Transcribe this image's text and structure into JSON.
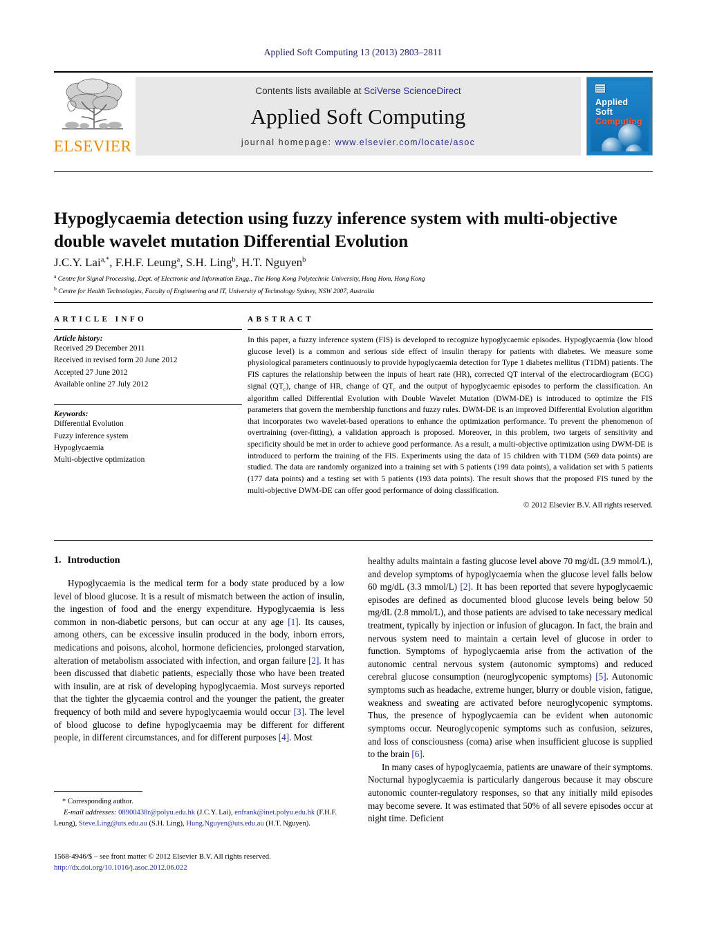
{
  "running_head": "Applied Soft Computing 13 (2013) 2803–2811",
  "masthead": {
    "publisher_name": "ELSEVIER",
    "contents_prefix": "Contents lists available at ",
    "contents_link": "SciVerse ScienceDirect",
    "journal_title": "Applied Soft Computing",
    "homepage_label": "journal homepage:",
    "homepage_url": "www.elsevier.com/locate/asoc",
    "cover": {
      "line1": "Applied",
      "line2": "Soft",
      "line3": "Computing",
      "bg_color": "#1b7fc4",
      "accent_color": "#ff5533"
    }
  },
  "article": {
    "title": "Hypoglycaemia detection using fuzzy inference system with multi-objective double wavelet mutation Differential Evolution",
    "authors_html": "J.C.Y. Lai<sup>a,*</sup>, F.H.F. Leung<sup>a</sup>, S.H. Ling<sup>b</sup>, H.T. Nguyen<sup>b</sup>",
    "affiliation_a": "Centre for Signal Processing, Dept. of Electronic and Information Engg., The Hong Kong Polytechnic University, Hung Hom, Hong Kong",
    "affiliation_b": "Centre for Health Technologies, Faculty of Engineering and IT, University of Technology Sydney, NSW 2007, Australia"
  },
  "article_info": {
    "heading": "ARTICLE INFO",
    "history_label": "Article history:",
    "history": [
      "Received 29 December 2011",
      "Received in revised form 20 June 2012",
      "Accepted 27 June 2012",
      "Available online 27 July 2012"
    ],
    "keywords_label": "Keywords:",
    "keywords": [
      "Differential Evolution",
      "Fuzzy inference system",
      "Hypoglycaemia",
      "Multi-objective optimization"
    ]
  },
  "abstract": {
    "heading": "ABSTRACT",
    "part1": "In this paper, a fuzzy inference system (FIS) is developed to recognize hypoglycaemic episodes. Hypoglycaemia (low blood glucose level) is a common and serious side effect of insulin therapy for patients with diabetes. We measure some physiological parameters continuously to provide hypoglycaemia detection for Type 1 diabetes mellitus (T1DM) patients. The FIS captures the relationship between the inputs of heart rate (HR), corrected QT interval of the electrocardiogram (ECG) signal (QT",
    "sub1": "c",
    "part2": "), change of HR, change of QT",
    "sub2": "c",
    "part3": " and the output of hypoglycaemic episodes to perform the classification. An algorithm called Differential Evolution with Double Wavelet Mutation (DWM-DE) is introduced to optimize the FIS parameters that govern the membership functions and fuzzy rules. DWM-DE is an improved Differential Evolution algorithm that incorporates two wavelet-based operations to enhance the optimization performance. To prevent the phenomenon of overtraining (over-fitting), a validation approach is proposed. Moreover, in this problem, two targets of sensitivity and specificity should be met in order to achieve good performance. As a result, a multi-objective optimization using DWM-DE is introduced to perform the training of the FIS. Experiments using the data of 15 children with T1DM (569 data points) are studied. The data are randomly organized into a training set with 5 patients (199 data points), a validation set with 5 patients (177 data points) and a testing set with 5 patients (193 data points). The result shows that the proposed FIS tuned by the multi-objective DWM-DE can offer good performance of doing classification.",
    "copyright": "© 2012 Elsevier B.V. All rights reserved."
  },
  "sections": {
    "intro_number": "1.",
    "intro_title": "Introduction"
  },
  "body": {
    "left_p1_a": "Hypoglycaemia is the medical term for a body state produced by a low level of blood glucose. It is a result of mismatch between the action of insulin, the ingestion of food and the energy expenditure. Hypoglycaemia is less common in non-diabetic persons, but can occur at any age ",
    "left_p1_cite1": "[1]",
    "left_p1_b": ". Its causes, among others, can be excessive insulin produced in the body, inborn errors, medications and poisons, alcohol, hormone deficiencies, prolonged starvation, alteration of metabolism associated with infection, and organ failure ",
    "left_p1_cite2": "[2]",
    "left_p1_c": ". It has been discussed that diabetic patients, especially those who have been treated with insulin, are at risk of developing hypoglycaemia. Most surveys reported that the tighter the glycaemia control and the younger the patient, the greater frequency of both mild and severe hypoglycaemia would occur ",
    "left_p1_cite3": "[3]",
    "left_p1_d": ". The level of blood glucose to define hypoglycaemia may be different for different people, in different circumstances, and for different purposes ",
    "left_p1_cite4": "[4]",
    "left_p1_e": ". Most",
    "right_p1_a": "healthy adults maintain a fasting glucose level above 70 mg/dL (3.9 mmol/L), and develop symptoms of hypoglycaemia when the glucose level falls below 60 mg/dL (3.3 mmol/L) ",
    "right_p1_cite1": "[2]",
    "right_p1_b": ". It has been reported that severe hypoglycaemic episodes are defined as documented blood glucose levels being below 50 mg/dL (2.8 mmol/L), and those patients are advised to take necessary medical treatment, typically by injection or infusion of glucagon. In fact, the brain and nervous system need to maintain a certain level of glucose in order to function. Symptoms of hypoglycaemia arise from the activation of the autonomic central nervous system (autonomic symptoms) and reduced cerebral glucose consumption (neuroglycopenic symptoms) ",
    "right_p1_cite2": "[5]",
    "right_p1_c": ". Autonomic symptoms such as headache, extreme hunger, blurry or double vision, fatigue, weakness and sweating are activated before neuroglycopenic symptoms. Thus, the presence of hypoglycaemia can be evident when autonomic symptoms occur. Neuroglycopenic symptoms such as confusion, seizures, and loss of consciousness (coma) arise when insufficient glucose is supplied to the brain ",
    "right_p1_cite3": "[6]",
    "right_p1_d": ".",
    "right_p2": "In many cases of hypoglycaemia, patients are unaware of their symptoms. Nocturnal hypoglycaemia is particularly dangerous because it may obscure autonomic counter-regulatory responses, so that any initially mild episodes may become severe. It was estimated that 50% of all severe episodes occur at night time. Deficient"
  },
  "footnote": {
    "corresponding": "* Corresponding author.",
    "email_label": "E-mail addresses:",
    "email1": "08900438r@polyu.edu.hk",
    "email1_owner": " (J.C.Y. Lai),",
    "email2": "enfrank@inet.polyu.edu.hk",
    "email2_owner": " (F.H.F. Leung),",
    "email3": "Steve.Ling@uts.edu.au",
    "email3_owner": " (S.H. Ling),",
    "email4": "Hung.Nguyen@uts.edu.au",
    "email4_owner": " (H.T. Nguyen)."
  },
  "imprint": {
    "line1": "1568-4946/$ – see front matter © 2012 Elsevier B.V. All rights reserved.",
    "doi": "http://dx.doi.org/10.1016/j.asoc.2012.06.022"
  }
}
